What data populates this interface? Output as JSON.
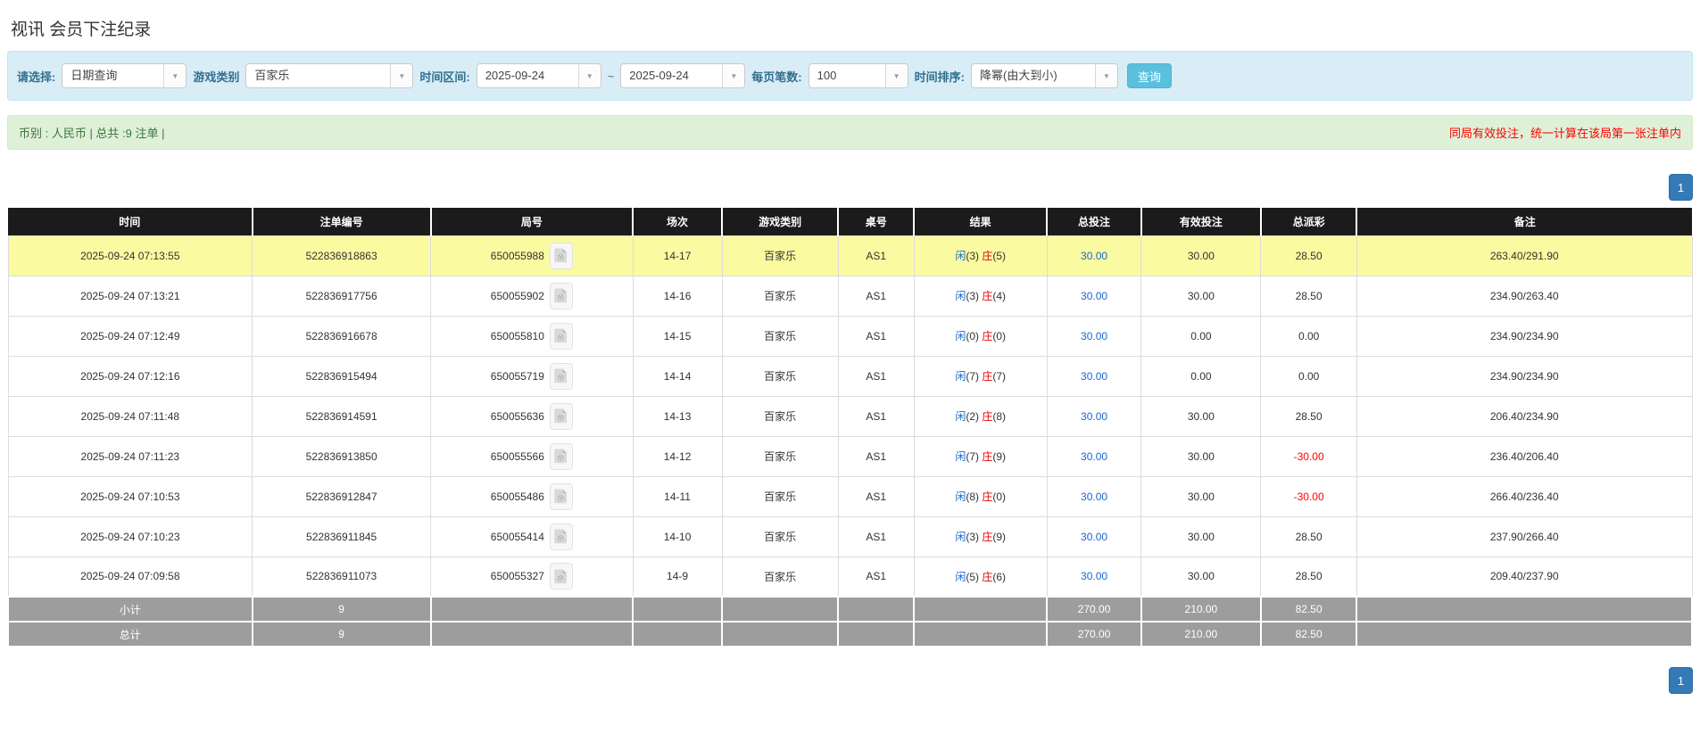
{
  "page": {
    "title": "视讯 会员下注纪录"
  },
  "filters": {
    "select_label": "请选择:",
    "select_value": "日期查询",
    "game_type_label": "游戏类别",
    "game_type_value": "百家乐",
    "time_range_label": "时间区间:",
    "date_from": "2025-09-24",
    "range_separator": "~",
    "date_to": "2025-09-24",
    "page_size_label": "每页笔数:",
    "page_size_value": "100",
    "sort_label": "时间排序:",
    "sort_value": "降幂(由大到小)",
    "search_button": "查询"
  },
  "info_bar": {
    "left_text": "币别 : 人民币 | 总共 :9 注单 |",
    "right_notice": "同局有效投注，统一计算在该局第一张注单内"
  },
  "pagination": {
    "page": "1"
  },
  "icons": {
    "video_replay": "video-replay-icon",
    "dropdown_arrow": "▼"
  },
  "table": {
    "columns": [
      "时间",
      "注单编号",
      "局号",
      "场次",
      "游戏类别",
      "桌号",
      "结果",
      "总投注",
      "有效投注",
      "总派彩",
      "备注"
    ],
    "result_labels": {
      "player": "闲",
      "banker": "庄"
    },
    "rows": [
      {
        "time": "2025-09-24 07:13:55",
        "bet_id": "522836918863",
        "round_id": "650055988",
        "session": "14-17",
        "game": "百家乐",
        "table_no": "AS1",
        "player_score": "3",
        "banker_score": "5",
        "total_bet": "30.00",
        "valid_bet": "30.00",
        "payout": "28.50",
        "remark": "263.40/291.90",
        "highlighted": true
      },
      {
        "time": "2025-09-24 07:13:21",
        "bet_id": "522836917756",
        "round_id": "650055902",
        "session": "14-16",
        "game": "百家乐",
        "table_no": "AS1",
        "player_score": "3",
        "banker_score": "4",
        "total_bet": "30.00",
        "valid_bet": "30.00",
        "payout": "28.50",
        "remark": "234.90/263.40",
        "highlighted": false
      },
      {
        "time": "2025-09-24 07:12:49",
        "bet_id": "522836916678",
        "round_id": "650055810",
        "session": "14-15",
        "game": "百家乐",
        "table_no": "AS1",
        "player_score": "0",
        "banker_score": "0",
        "total_bet": "30.00",
        "valid_bet": "0.00",
        "payout": "0.00",
        "remark": "234.90/234.90",
        "highlighted": false
      },
      {
        "time": "2025-09-24 07:12:16",
        "bet_id": "522836915494",
        "round_id": "650055719",
        "session": "14-14",
        "game": "百家乐",
        "table_no": "AS1",
        "player_score": "7",
        "banker_score": "7",
        "total_bet": "30.00",
        "valid_bet": "0.00",
        "payout": "0.00",
        "remark": "234.90/234.90",
        "highlighted": false
      },
      {
        "time": "2025-09-24 07:11:48",
        "bet_id": "522836914591",
        "round_id": "650055636",
        "session": "14-13",
        "game": "百家乐",
        "table_no": "AS1",
        "player_score": "2",
        "banker_score": "8",
        "total_bet": "30.00",
        "valid_bet": "30.00",
        "payout": "28.50",
        "remark": "206.40/234.90",
        "highlighted": false
      },
      {
        "time": "2025-09-24 07:11:23",
        "bet_id": "522836913850",
        "round_id": "650055566",
        "session": "14-12",
        "game": "百家乐",
        "table_no": "AS1",
        "player_score": "7",
        "banker_score": "9",
        "total_bet": "30.00",
        "valid_bet": "30.00",
        "payout": "-30.00",
        "remark": "236.40/206.40",
        "highlighted": false
      },
      {
        "time": "2025-09-24 07:10:53",
        "bet_id": "522836912847",
        "round_id": "650055486",
        "session": "14-11",
        "game": "百家乐",
        "table_no": "AS1",
        "player_score": "8",
        "banker_score": "0",
        "total_bet": "30.00",
        "valid_bet": "30.00",
        "payout": "-30.00",
        "remark": "266.40/236.40",
        "highlighted": false
      },
      {
        "time": "2025-09-24 07:10:23",
        "bet_id": "522836911845",
        "round_id": "650055414",
        "session": "14-10",
        "game": "百家乐",
        "table_no": "AS1",
        "player_score": "3",
        "banker_score": "9",
        "total_bet": "30.00",
        "valid_bet": "30.00",
        "payout": "28.50",
        "remark": "237.90/266.40",
        "highlighted": false
      },
      {
        "time": "2025-09-24 07:09:58",
        "bet_id": "522836911073",
        "round_id": "650055327",
        "session": "14-9",
        "game": "百家乐",
        "table_no": "AS1",
        "player_score": "5",
        "banker_score": "6",
        "total_bet": "30.00",
        "valid_bet": "30.00",
        "payout": "28.50",
        "remark": "209.40/237.90",
        "highlighted": false
      }
    ],
    "summaries": [
      {
        "label": "小计",
        "count": "9",
        "total_bet": "270.00",
        "valid_bet": "210.00",
        "payout": "82.50"
      },
      {
        "label": "总计",
        "count": "9",
        "total_bet": "270.00",
        "valid_bet": "210.00",
        "payout": "82.50"
      }
    ]
  },
  "colors": {
    "accent_blue": "#337ab7",
    "link_blue": "#1a66cc",
    "player_blue": "#1a66cc",
    "banker_red": "#e60000",
    "negative_red": "#ff0000",
    "highlight_yellow": "#fafaa0",
    "header_black": "#1b1b1b",
    "summary_gray": "#9d9d9d",
    "filter_bar_bg": "#d9edf7",
    "info_bar_bg": "#dff0d8",
    "search_button_bg": "#5bc0de"
  }
}
